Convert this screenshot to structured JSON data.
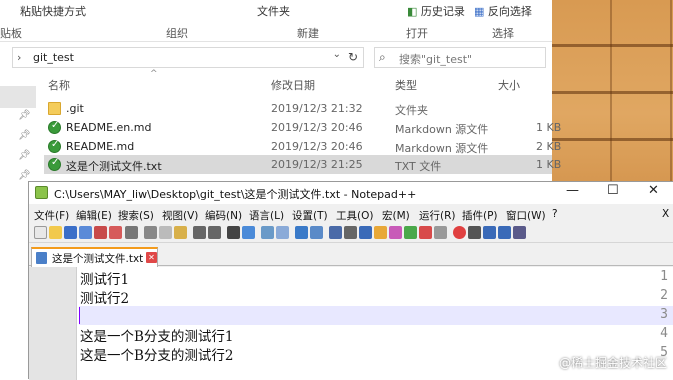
{
  "explorer": {
    "ribbon_top": {
      "left_fragment": "粘贴快捷方式",
      "center": "文件夹",
      "history": "历史记录",
      "right_fragment": "反向选择"
    },
    "ribbon_groups": {
      "clipboard_fragment": "贴板",
      "organize": "组织",
      "new": "新建",
      "open": "打开",
      "select": "选择"
    },
    "address": {
      "path": "git_test",
      "separator": "›",
      "dropdown": "⌄",
      "refresh": "↻"
    },
    "search": {
      "placeholder": "搜索\"git_test\"",
      "icon": "search-icon"
    },
    "columns": {
      "name": "名称",
      "date": "修改日期",
      "type": "类型",
      "size": "大小"
    },
    "files": [
      {
        "name": ".git",
        "date": "2019/12/3 21:32",
        "type": "文件夹",
        "size": "",
        "icon": "folder-icon"
      },
      {
        "name": "README.en.md",
        "date": "2019/12/3 20:46",
        "type": "Markdown 源文件",
        "size": "1 KB",
        "icon": "git-file-icon"
      },
      {
        "name": "README.md",
        "date": "2019/12/3 20:46",
        "type": "Markdown 源文件",
        "size": "2 KB",
        "icon": "git-file-icon"
      },
      {
        "name": "这是个测试文件.txt",
        "date": "2019/12/3 21:25",
        "type": "TXT 文件",
        "size": "1 KB",
        "icon": "git-file-icon"
      }
    ]
  },
  "notepad": {
    "title": "C:\\Users\\MAY_liw\\Desktop\\git_test\\这是个测试文件.txt - Notepad++",
    "window_buttons": {
      "minimize": "—",
      "maximize": "☐",
      "close": "✕"
    },
    "menu": [
      "文件(F)",
      "编辑(E)",
      "搜索(S)",
      "视图(V)",
      "编码(N)",
      "语言(L)",
      "设置(T)",
      "工具(O)",
      "宏(M)",
      "运行(R)",
      "插件(P)",
      "窗口(W)",
      "?"
    ],
    "menu_close": "X",
    "tab": {
      "label": "这是个测试文件.txt",
      "close": "✕"
    },
    "lines": [
      {
        "num": "1",
        "text": "测试行1"
      },
      {
        "num": "2",
        "text": "测试行2"
      },
      {
        "num": "3",
        "text": ""
      },
      {
        "num": "4",
        "text": "这是一个B分支的测试行1"
      },
      {
        "num": "5",
        "text": "这是一个B分支的测试行2"
      }
    ]
  },
  "watermark": "@稀土掘金技术社区",
  "colors": {
    "tab_accent": "#f39b1c",
    "current_line": "#e8e8ff",
    "caret": "#8000ff",
    "selected_row": "#d9d9d9"
  }
}
